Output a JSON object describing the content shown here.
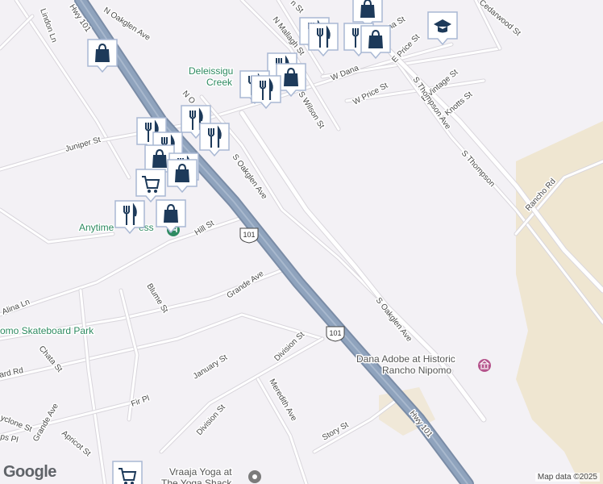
{
  "map": {
    "streets": [
      {
        "key": "hwy101-top",
        "text": "Hwy 101"
      },
      {
        "key": "lindon",
        "text": "Lindon Ln"
      },
      {
        "key": "n-oakglen",
        "text": "N Oakglen Ave"
      },
      {
        "key": "n-oakglen-2",
        "text": "N O"
      },
      {
        "key": "juniper",
        "text": "Juniper St"
      },
      {
        "key": "n-mallagh",
        "text": "N Mallagh St"
      },
      {
        "key": "n-wilson-top",
        "text": "n St"
      },
      {
        "key": "s-wilson",
        "text": "S Wilson St"
      },
      {
        "key": "w-dana",
        "text": "W Dana"
      },
      {
        "key": "dana",
        "text": "ana St"
      },
      {
        "key": "e-price",
        "text": "E Price St"
      },
      {
        "key": "w-price",
        "text": "W Price St"
      },
      {
        "key": "e-vintage",
        "text": "E Vintage St"
      },
      {
        "key": "e-knotts",
        "text": "E Knotts St"
      },
      {
        "key": "cedarwood",
        "text": "Cedarwood St"
      },
      {
        "key": "s-thompson",
        "text": "S Thompson Ave"
      },
      {
        "key": "s-thompson-2",
        "text": "S Thompson"
      },
      {
        "key": "rancho",
        "text": "Rancho Rd"
      },
      {
        "key": "st-tail",
        "text": "St"
      },
      {
        "key": "s-oakglen",
        "text": "S Oakglen Ave"
      },
      {
        "key": "s-oakglen-2",
        "text": "S Oakglen Ave"
      },
      {
        "key": "hill",
        "text": "Hill St"
      },
      {
        "key": "grande",
        "text": "Grande Ave"
      },
      {
        "key": "blume",
        "text": "Blume St"
      },
      {
        "key": "alina",
        "text": "Alina Ln"
      },
      {
        "key": "chata",
        "text": "Chata St"
      },
      {
        "key": "ard",
        "text": "ard Rd"
      },
      {
        "key": "january",
        "text": "January St"
      },
      {
        "key": "division",
        "text": "Division St"
      },
      {
        "key": "division-2",
        "text": "Division St"
      },
      {
        "key": "meredith",
        "text": "Meredith Ave"
      },
      {
        "key": "fir",
        "text": "Fir Pl"
      },
      {
        "key": "grande-2",
        "text": "Grande Ave"
      },
      {
        "key": "cyclone",
        "text": "yclone St"
      },
      {
        "key": "ps",
        "text": "ps Pl"
      },
      {
        "key": "apricot",
        "text": "Apricot St"
      },
      {
        "key": "story",
        "text": "Story St"
      },
      {
        "key": "hwy101-bottom",
        "text": "Hwy 101"
      }
    ],
    "shields": [
      {
        "key": "shield-1",
        "text": "101"
      },
      {
        "key": "shield-2",
        "text": "101"
      }
    ],
    "places": [
      {
        "key": "deleissigues",
        "lines": [
          "Deleissigu",
          "Creek"
        ]
      },
      {
        "key": "anytime",
        "lines": [
          "Anytime",
          "ess"
        ]
      },
      {
        "key": "skatepark",
        "lines": [
          "omo Skateboard Park"
        ]
      },
      {
        "key": "dana-adobe",
        "lines": [
          "Dana Adobe at Historic",
          "Rancho Nipomo"
        ]
      },
      {
        "key": "vraaja",
        "lines": [
          "Vraaja Yoga at",
          "The Yoga Shack"
        ]
      }
    ],
    "markers": [
      {
        "key": "m1",
        "icon": "shopping-bag"
      },
      {
        "key": "m2",
        "icon": "shopping-bag"
      },
      {
        "key": "m3",
        "icon": "fork-knife"
      },
      {
        "key": "m4",
        "icon": "fork-knife"
      },
      {
        "key": "m5",
        "icon": "fork-knife"
      },
      {
        "key": "m6",
        "icon": "shopping-bag"
      },
      {
        "key": "m7",
        "icon": "graduation-cap"
      },
      {
        "key": "m8",
        "icon": "fork-knife"
      },
      {
        "key": "m9",
        "icon": "fork-knife"
      },
      {
        "key": "m10",
        "icon": "shopping-bag"
      },
      {
        "key": "m11",
        "icon": "fork-knife"
      },
      {
        "key": "m12",
        "icon": "fork-knife"
      },
      {
        "key": "m13",
        "icon": "fork-knife"
      },
      {
        "key": "m14",
        "icon": "fork-knife"
      },
      {
        "key": "m15",
        "icon": "fork-knife"
      },
      {
        "key": "m16",
        "icon": "shopping-bag"
      },
      {
        "key": "m17",
        "icon": "shopping-cart"
      },
      {
        "key": "m18",
        "icon": "fork-knife"
      },
      {
        "key": "m19",
        "icon": "shopping-bag"
      },
      {
        "key": "m20",
        "icon": "shopping-bag"
      },
      {
        "key": "m21",
        "icon": "fork-knife"
      },
      {
        "key": "m22",
        "icon": "shopping-cart"
      }
    ],
    "colors": {
      "land": "#f3f1f5",
      "highway_fill": "#8fa3bd",
      "highway_edge": "#7a8ca6",
      "road": "#ffffff",
      "marker_fill": "#1d3a5a",
      "marker_bg": "#ffffff",
      "marker_border": "#a9b8d4",
      "park_green": "#2e8a61",
      "sand": "#efe6d1"
    }
  },
  "footer": {
    "logo_text": "Google",
    "attribution": "Map data ©2025"
  }
}
